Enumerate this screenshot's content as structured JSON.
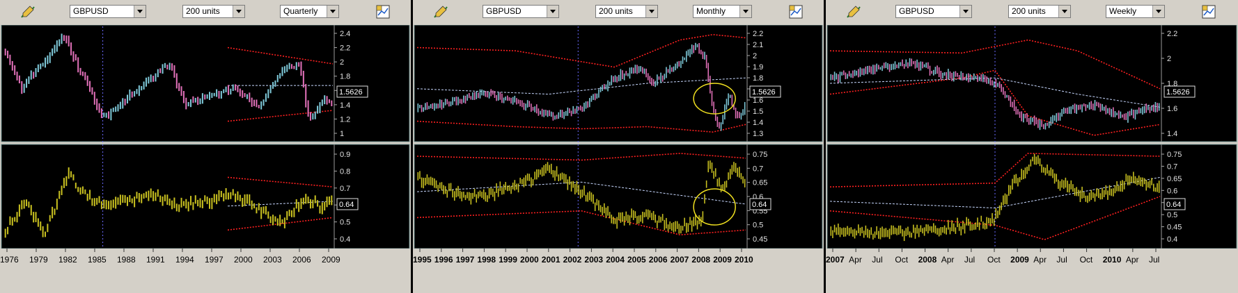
{
  "panels": [
    {
      "symbol": "GBPUSD",
      "units": "200 units",
      "period": "Quarterly",
      "price_label": "1.5626",
      "ind_label": "0.64",
      "x_labels": [
        "1976",
        "1979",
        "1982",
        "1985",
        "1988",
        "1991",
        "1994",
        "1997",
        "2000",
        "2003",
        "2006",
        "2009"
      ],
      "price_ticks": [
        "2.4",
        "2.2",
        "2",
        "1.8",
        "1.6",
        "1.4",
        "1.2",
        "1"
      ],
      "ind_ticks": [
        "0.9",
        "0.8",
        "0.7",
        "0.6",
        "0.5",
        "0.4"
      ]
    },
    {
      "symbol": "GBPUSD",
      "units": "200 units",
      "period": "Monthly",
      "price_label": "1.5626",
      "ind_label": "0.64",
      "x_labels": [
        "1995",
        "1996",
        "1997",
        "1998",
        "1999",
        "2000",
        "2001",
        "2002",
        "2003",
        "2004",
        "2005",
        "2006",
        "2007",
        "2008",
        "2009",
        "2010"
      ],
      "price_ticks": [
        "2.2",
        "2.1",
        "2",
        "1.9",
        "1.8",
        "1.7",
        "1.6",
        "1.5",
        "1.4",
        "1.3"
      ],
      "ind_ticks": [
        "0.75",
        "0.7",
        "0.65",
        "0.6",
        "0.55",
        "0.5",
        "0.45"
      ]
    },
    {
      "symbol": "GBPUSD",
      "units": "200 units",
      "period": "Weekly",
      "price_label": "1.5626",
      "ind_label": "0.64",
      "x_labels": [
        "2007",
        "Apr",
        "Jul",
        "Oct",
        "2008",
        "Apr",
        "Jul",
        "Oct",
        "2009",
        "Apr",
        "Jul",
        "Oct",
        "2010",
        "Apr",
        "Jul"
      ],
      "price_ticks": [
        "2.2",
        "2",
        "1.8",
        "1.6",
        "1.4"
      ],
      "ind_ticks": [
        "0.75",
        "0.7",
        "0.65",
        "0.6",
        "0.55",
        "0.5",
        "0.45",
        "0.4"
      ]
    }
  ],
  "colors": {
    "background": "#000000",
    "frame": "#d4d0c8",
    "bull_bar": "#7ec8d8",
    "bear_bar": "#e070b8",
    "indicator": "#c8c020",
    "band": "#ff2020",
    "midline": "#c8d8ff",
    "cursor": "#6a6aff",
    "highlight": "#f0e020"
  },
  "icons": [
    "pencil-chart-icon",
    "chart-settings-icon"
  ]
}
